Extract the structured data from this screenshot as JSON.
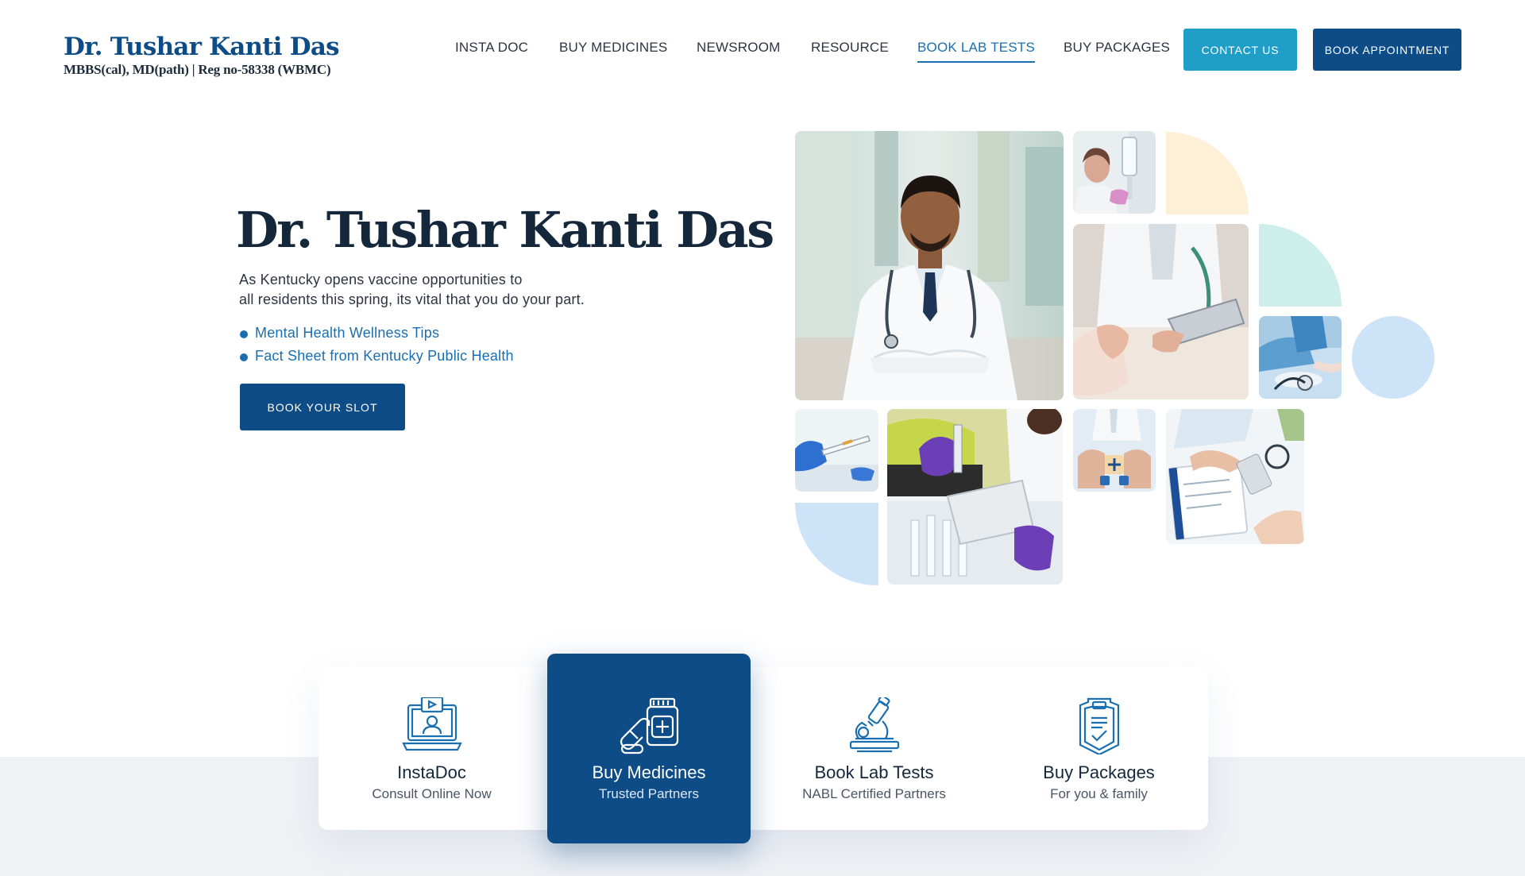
{
  "brand": {
    "name": "Dr. Tushar Kanti Das",
    "subtitle": "MBBS(cal), MD(path) | Reg no-58338 (WBMC)"
  },
  "nav": {
    "items": [
      "INSTA DOC",
      "BUY MEDICINES",
      "NEWSROOM",
      "RESOURCE",
      "BOOK LAB TESTS",
      "BUY PACKAGES"
    ],
    "active": "BOOK LAB TESTS",
    "contact_label": "CONTACT US",
    "appointment_label": "BOOK APPOINTMENT"
  },
  "hero": {
    "title": "Dr. Tushar Kanti Das",
    "description_line1": "As Kentucky opens vaccine opportunities to",
    "description_line2": "all residents this spring, its vital that you do your part.",
    "links": [
      "Mental Health Wellness Tips",
      "Fact Sheet from Kentucky Public Health"
    ],
    "cta_label": "BOOK YOUR SLOT"
  },
  "collage": {
    "photos": [
      "doctor-portrait",
      "iv-drip-nurse",
      "doctor-with-tablet",
      "stethoscope-consult",
      "syringe-vial",
      "lab-researcher",
      "hands-with-icons",
      "prescription-pills",
      "test-tubes"
    ],
    "accent_colors": {
      "cream": "#fdf0d6",
      "mint": "#cdeeea",
      "light_blue": "#cde3f8"
    }
  },
  "services": [
    {
      "title": "InstaDoc",
      "subtitle": "Consult Online Now",
      "icon": "video-consult-icon",
      "featured": false
    },
    {
      "title": "Buy Medicines",
      "subtitle": "Trusted Partners",
      "icon": "medicine-bottle-icon",
      "featured": true
    },
    {
      "title": "Book Lab Tests",
      "subtitle": "NABL Certified Partners",
      "icon": "microscope-icon",
      "featured": false
    },
    {
      "title": "Buy Packages",
      "subtitle": "For you & family",
      "icon": "clipboard-check-icon",
      "featured": false
    }
  ],
  "colors": {
    "primary": "#0d4c86",
    "accent": "#1f9fc7",
    "link": "#1a6fb0",
    "band": "#eff1f5"
  }
}
